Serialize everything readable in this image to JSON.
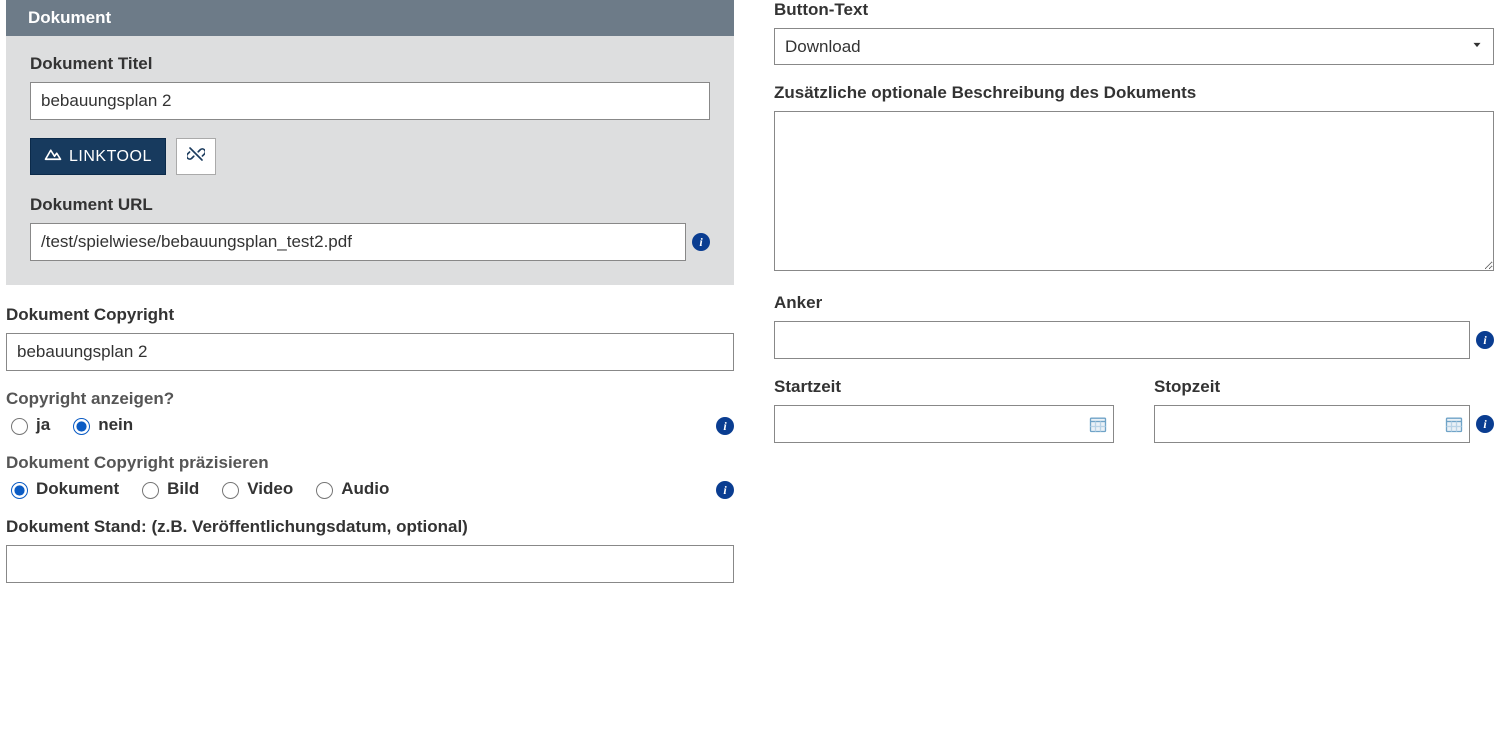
{
  "panel": {
    "title": "Dokument",
    "doc_title_label": "Dokument Titel",
    "doc_title_value": "bebauungsplan 2",
    "linktool_label": "LINKTOOL",
    "doc_url_label": "Dokument URL",
    "doc_url_value": "/test/spielwiese/bebauungsplan_test2.pdf"
  },
  "copyright": {
    "label": "Dokument Copyright",
    "value": "bebauungsplan 2",
    "show_label": "Copyright anzeigen?",
    "opt_yes": "ja",
    "opt_no": "nein",
    "selected": "nein",
    "precise_label": "Dokument Copyright präzisieren",
    "opts": {
      "doc": "Dokument",
      "img": "Bild",
      "vid": "Video",
      "aud": "Audio"
    },
    "precise_selected": "Dokument"
  },
  "stand": {
    "label": "Dokument Stand: (z.B. Veröffentlichungsdatum, optional)",
    "value": ""
  },
  "right": {
    "button_text_label": "Button-Text",
    "button_text_value": "Download",
    "description_label": "Zusätzliche optionale Beschreibung des Dokuments",
    "description_value": "",
    "anchor_label": "Anker",
    "anchor_value": "",
    "start_label": "Startzeit",
    "start_value": "",
    "stop_label": "Stopzeit",
    "stop_value": ""
  }
}
